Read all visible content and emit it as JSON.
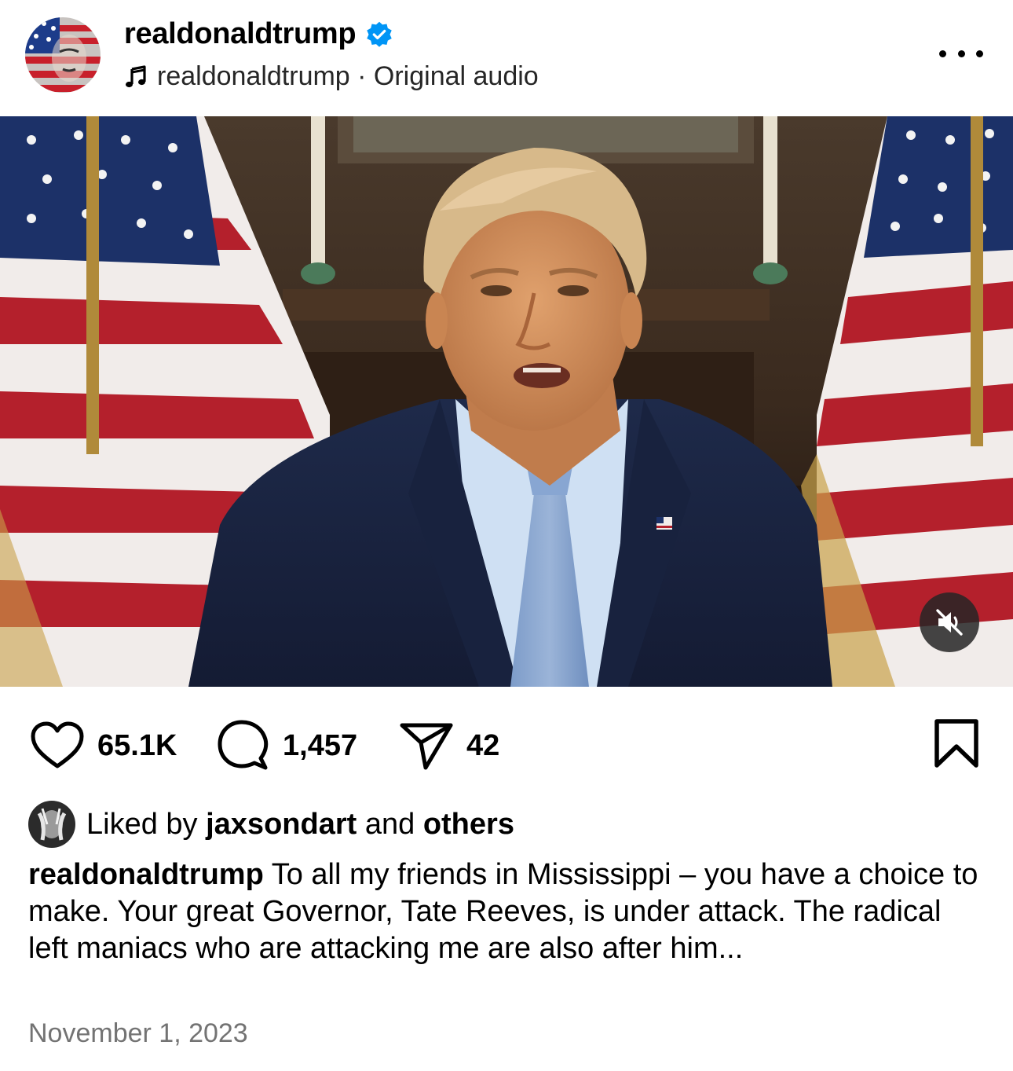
{
  "header": {
    "username": "realdonaldtrump",
    "verified_icon": "verified-badge-icon",
    "audio_icon": "music-note-icon",
    "audio_text": "realdonaldtrump · Original audio",
    "more_icon": "more-options-icon"
  },
  "media": {
    "type": "video",
    "mute_icon": "muted-speaker-icon"
  },
  "actions": {
    "likes_count": "65.1K",
    "comments_count": "1,457",
    "shares_count": "42",
    "like_icon": "heart-icon",
    "comment_icon": "comment-bubble-icon",
    "share_icon": "send-icon",
    "save_icon": "bookmark-icon"
  },
  "liked_by": {
    "prefix": "Liked by",
    "user": "jaxsondart",
    "connector": "and",
    "others": "others"
  },
  "caption": {
    "author": "realdonaldtrump",
    "text": "To all my friends in Mississippi – you have a choice to make. Your great Governor, Tate Reeves, is under attack. The radical left maniacs who are attacking me are also after him..."
  },
  "timestamp": "November 1, 2023",
  "colors": {
    "verified_blue": "#0095f6",
    "text_primary": "#000000",
    "text_secondary": "#737373"
  }
}
